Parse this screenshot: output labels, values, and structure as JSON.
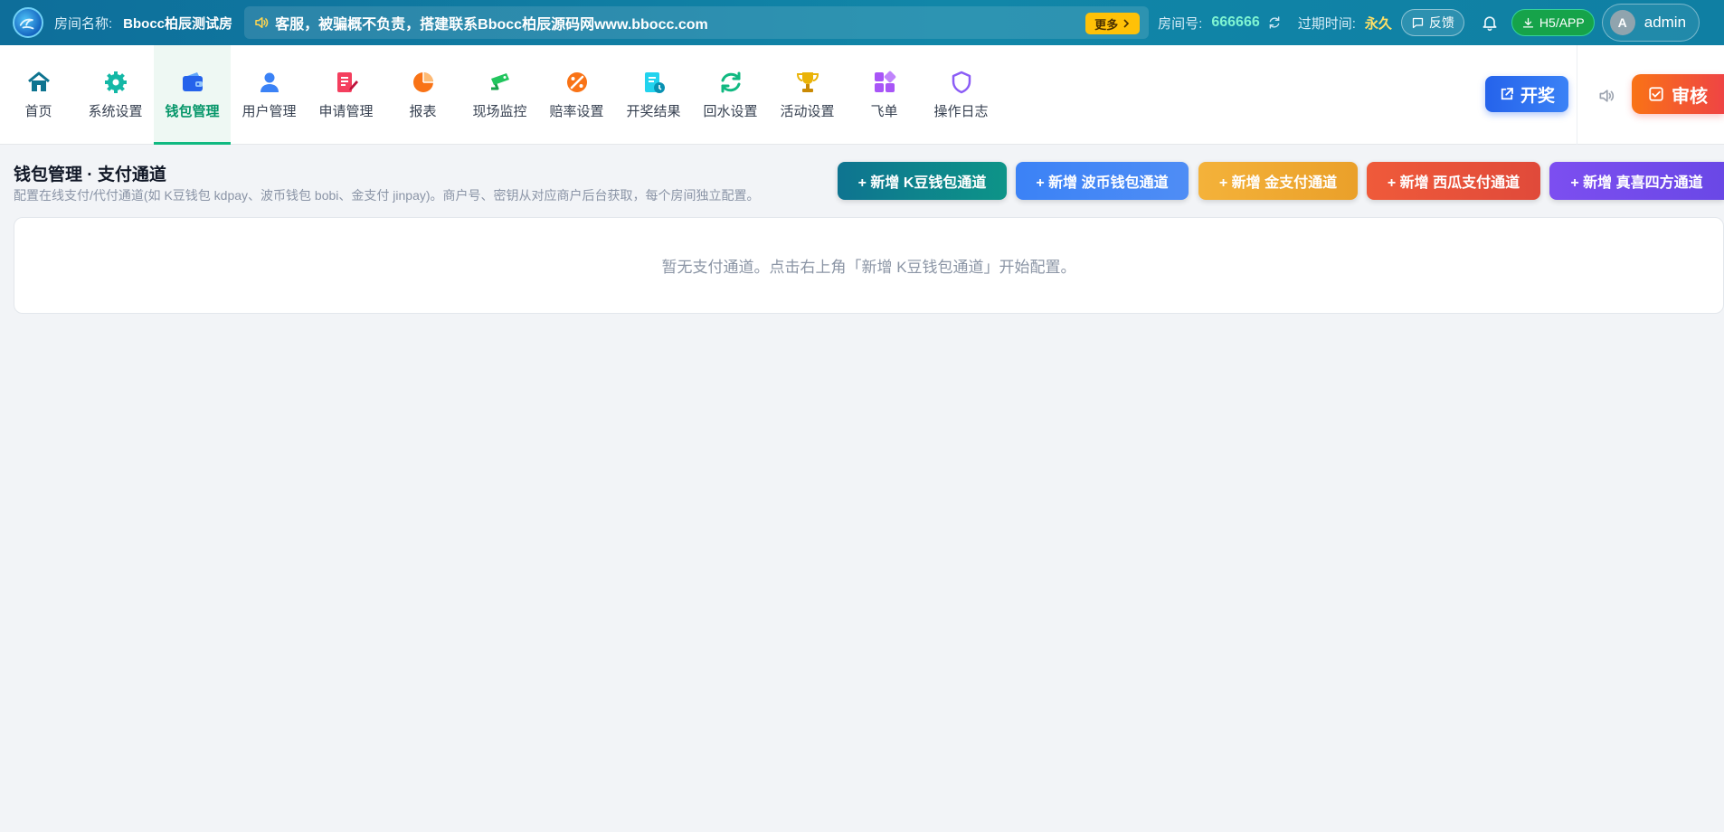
{
  "topbar": {
    "room_label": "房间名称:",
    "room_name": "Bbocc柏辰测试房",
    "marquee_text": "客服，被骗概不负责，搭建联系Bbocc柏辰源码网www.bbocc.com",
    "more_label": "更多",
    "roomno_label": "房间号:",
    "roomno": "666666",
    "expire_label": "过期时间:",
    "expire": "永久",
    "feedback_label": "反馈",
    "h5_label": "H5/APP",
    "avatar_letter": "A",
    "username": "admin"
  },
  "nav": {
    "items": [
      {
        "label": "首页",
        "icon": "home-icon",
        "color": "#0e7490"
      },
      {
        "label": "系统设置",
        "icon": "gear-icon",
        "color": "#14b8a6"
      },
      {
        "label": "钱包管理",
        "icon": "wallet-icon",
        "color": "#2563eb",
        "active": true
      },
      {
        "label": "用户管理",
        "icon": "user-icon",
        "color": "#3b82f6"
      },
      {
        "label": "申请管理",
        "icon": "edit-doc-icon",
        "color": "#f43f5e"
      },
      {
        "label": "报表",
        "icon": "pie-chart-icon",
        "color": "#f97316"
      },
      {
        "label": "现场监控",
        "icon": "camera-icon",
        "color": "#22c55e"
      },
      {
        "label": "赔率设置",
        "icon": "percent-icon",
        "color": "#f97316"
      },
      {
        "label": "开奖结果",
        "icon": "result-doc-icon",
        "color": "#22d3ee"
      },
      {
        "label": "回水设置",
        "icon": "refresh-icon",
        "color": "#10b981"
      },
      {
        "label": "活动设置",
        "icon": "trophy-icon",
        "color": "#eab308"
      },
      {
        "label": "飞单",
        "icon": "grid-icon",
        "color": "#a855f7"
      },
      {
        "label": "操作日志",
        "icon": "shield-icon",
        "color": "#8b5cf6"
      }
    ],
    "draw_label": "开奖",
    "audit_label": "审核"
  },
  "main": {
    "title": "钱包管理 · 支付通道",
    "desc": "配置在线支付/代付通道(如 K豆钱包 kdpay、波币钱包 bobi、金支付 jinpay)。商户号、密钥从对应商户后台获取，每个房间独立配置。",
    "buttons": [
      {
        "label": "+ 新增 K豆钱包通道",
        "color": "#0f8a8a"
      },
      {
        "label": "+ 新增 波币钱包通道",
        "color": "#3b82f6"
      },
      {
        "label": "+ 新增 金支付通道",
        "color": "#f0a52c"
      },
      {
        "label": "+ 新增 西瓜支付通道",
        "color": "#e8533a"
      },
      {
        "label": "+ 新增 真喜四方通道",
        "color": "#6d4ee8"
      }
    ],
    "empty_text": "暂无支付通道。点击右上角「新增 K豆钱包通道」开始配置。"
  },
  "colors": {
    "topbar": "#0f7fa3",
    "active_nav": "#10b981",
    "draw_button": "#2563eb",
    "audit_button": "#f05a28"
  }
}
